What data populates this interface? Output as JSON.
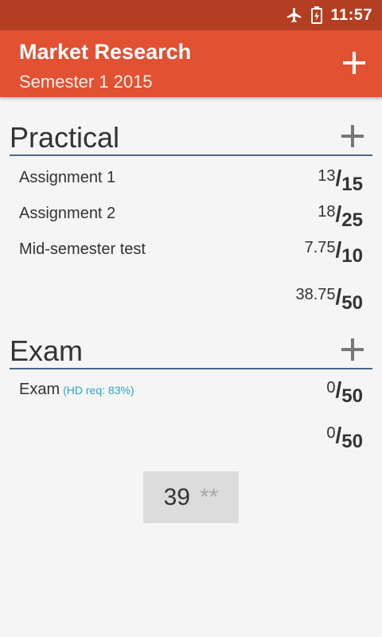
{
  "statusbar": {
    "time": "11:57"
  },
  "appbar": {
    "title": "Market Research",
    "subtitle": "Semester 1 2015"
  },
  "practical": {
    "title": "Practical",
    "items": [
      {
        "label": "Assignment 1",
        "score": "13",
        "max": "15"
      },
      {
        "label": "Assignment 2",
        "score": "18",
        "max": "25"
      },
      {
        "label": "Mid-semester test",
        "score": "7.75",
        "max": "10"
      }
    ],
    "total": {
      "score": "38.75",
      "max": "50"
    }
  },
  "exam": {
    "title": "Exam",
    "items": [
      {
        "label": "Exam",
        "hint": "(HD req: 83%)",
        "score": "0",
        "max": "50"
      }
    ],
    "total": {
      "score": "0",
      "max": "50"
    }
  },
  "final": {
    "value": "39",
    "grade": "**"
  }
}
